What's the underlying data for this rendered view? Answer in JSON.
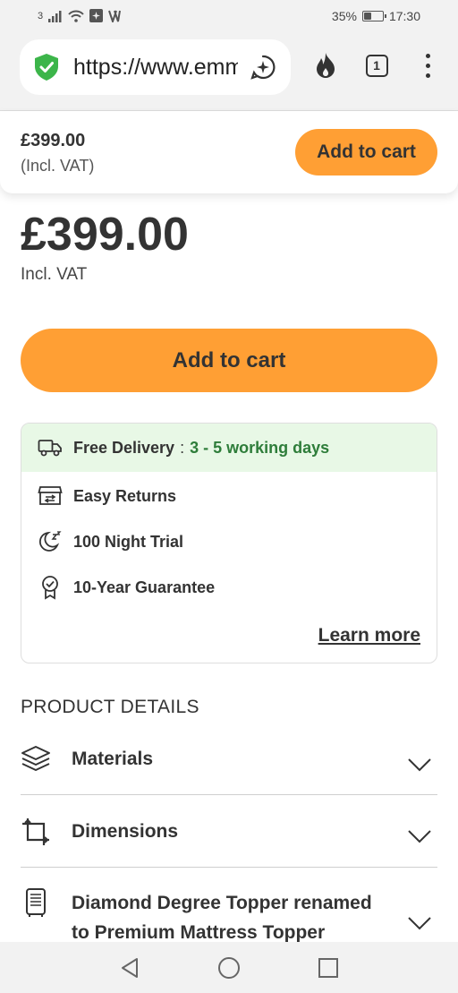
{
  "status_bar": {
    "sim": "3",
    "battery_pct": "35%",
    "battery_level": 0.35,
    "time": "17:30"
  },
  "browser": {
    "url": "https://www.emma-mattress.co.uk",
    "tab_count": "1"
  },
  "sticky_header": {
    "price": "£399.00",
    "vat": "(Incl. VAT)",
    "cart_label": "Add to cart"
  },
  "product": {
    "price": "£399.00",
    "vat": "Incl. VAT",
    "cart_label": "Add to cart"
  },
  "benefits": {
    "delivery_label": "Free Delivery",
    "delivery_sep": ":",
    "delivery_value": "3 - 5 working days",
    "returns": "Easy Returns",
    "trial": "100 Night Trial",
    "guarantee": "10-Year Guarantee",
    "learn_more": "Learn more"
  },
  "product_details": {
    "title": "PRODUCT DETAILS",
    "items": [
      {
        "label": "Materials"
      },
      {
        "label": "Dimensions"
      },
      {
        "label_line1": "Diamond Degree Topper renamed",
        "label_line2": "to Premium Mattress Topper"
      }
    ]
  },
  "colors": {
    "accent": "#ff9f34",
    "delivery_bg": "#e8f8e6",
    "delivery_text": "#2e7d3a",
    "shield": "#3cb54a"
  }
}
